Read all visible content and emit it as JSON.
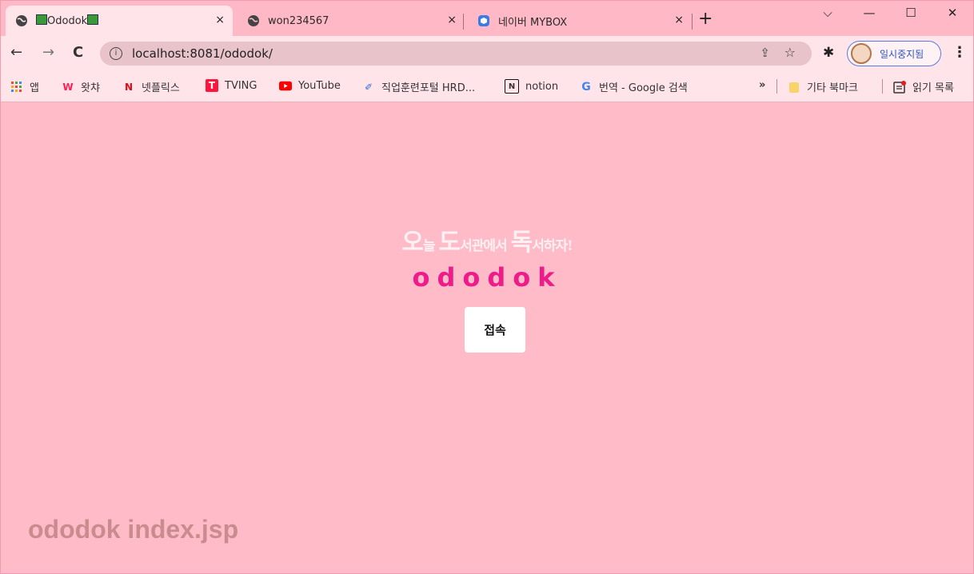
{
  "browser": {
    "tabs": [
      {
        "title": "Ododok",
        "close": "×"
      },
      {
        "title": "won234567",
        "close": "×"
      },
      {
        "title": "네이버 MYBOX",
        "close": "×"
      }
    ],
    "new_tab": "+",
    "window_controls": {
      "minimize": "—",
      "maximize": "☐",
      "close": "✕",
      "dropdown": "⌵"
    },
    "nav": {
      "back": "←",
      "forward": "→",
      "reload": "C"
    },
    "url": "localhost:8081/ododok/",
    "profile_status": "일시중지됨",
    "bookmarks": [
      {
        "label": "앱",
        "icon": "apps-grid"
      },
      {
        "label": "왓챠",
        "icon": "watcha"
      },
      {
        "label": "넷플릭스",
        "icon": "netflix"
      },
      {
        "label": "TVING",
        "icon": "tving"
      },
      {
        "label": "YouTube",
        "icon": "youtube"
      },
      {
        "label": "직업훈련포털 HRD...",
        "icon": "hrd"
      },
      {
        "label": "notion",
        "icon": "notion"
      },
      {
        "label": "번역 - Google 검색",
        "icon": "google"
      }
    ],
    "bookmarks_overflow": "»",
    "other_bookmarks": "기타 북마크",
    "reading_list": "읽기 목록"
  },
  "page": {
    "slogan": {
      "o": "오",
      "neul": "늘 ",
      "do": "도",
      "seogwan": "서관에서 ",
      "dok": "독",
      "seohaja": "서하자!"
    },
    "brand": "ododok",
    "enter_button": "접속",
    "footer_label": "ododok index.jsp"
  },
  "colors": {
    "page_bg": "#ffbcc8",
    "brand": "#ee1c8a",
    "slogan": "#fff0f3",
    "footer_label": "#c98c8e"
  }
}
